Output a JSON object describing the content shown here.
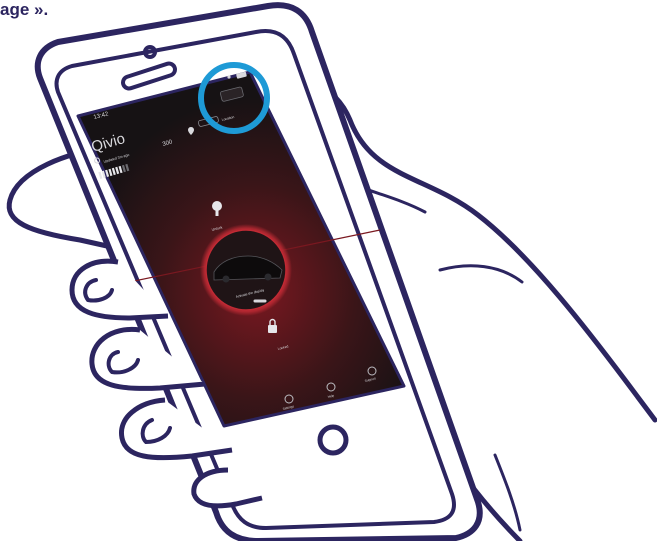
{
  "caption": "age ».",
  "colors": {
    "outline": "#2c2560",
    "highlight": "#1e9ad6",
    "screen_dark": "#1c1719",
    "accent_red": "#a3212b",
    "screen_text": "#d9d9dd"
  },
  "status_bar": {
    "time": "13:42"
  },
  "app": {
    "brand": "Qivio",
    "updated": "Updated 3m ago",
    "range_value": "300",
    "location_label": "Location",
    "tabs": {
      "lock_label": "Unlock",
      "center_label": "Activate the display",
      "bottom_lock_label": "Locked"
    },
    "bottom_nav": [
      {
        "label": "Settings",
        "icon": "gear-icon"
      },
      {
        "label": "Help",
        "icon": "help-icon"
      },
      {
        "label": "Support",
        "icon": "support-icon"
      }
    ]
  }
}
